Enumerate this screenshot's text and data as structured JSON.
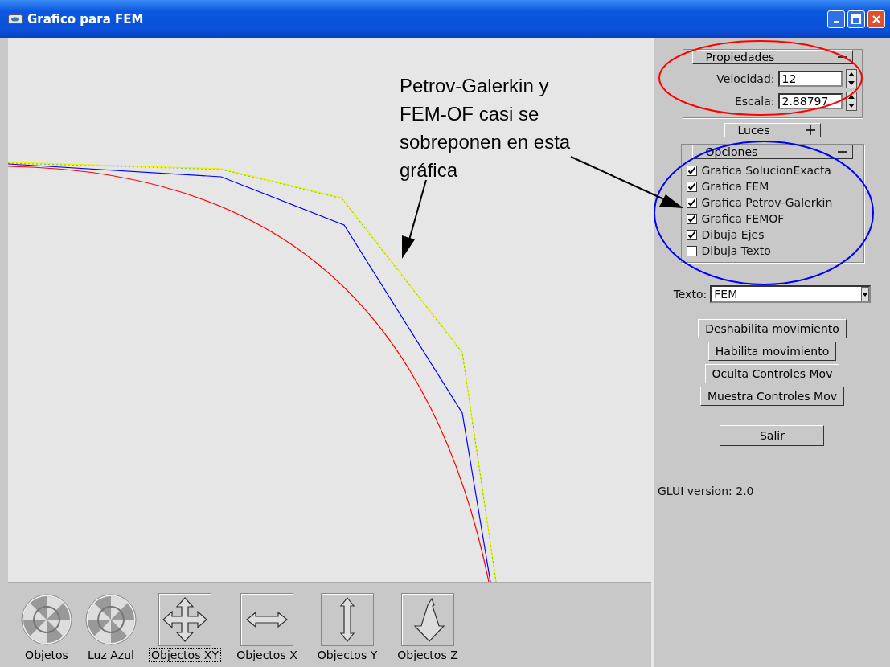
{
  "window": {
    "title": "Grafico para FEM"
  },
  "canvas": {
    "annotation": [
      "Petrov-Galerkin y",
      "FEM-OF casi se",
      "sobreponen en esta",
      "gráfica"
    ]
  },
  "panel": {
    "propiedades": {
      "title": "Propiedades",
      "expanded": true,
      "fields": [
        {
          "label": "Velocidad:",
          "value": "12"
        },
        {
          "label": "Escala:",
          "value": "2.88797"
        }
      ]
    },
    "luces": {
      "title": "Luces",
      "expanded": false
    },
    "opciones": {
      "title": "Opciones",
      "expanded": true,
      "checkboxes": [
        {
          "label": "Grafica SolucionExacta",
          "checked": true
        },
        {
          "label": "Grafica FEM",
          "checked": true
        },
        {
          "label": "Grafica Petrov-Galerkin",
          "checked": true
        },
        {
          "label": "Grafica FEMOF",
          "checked": true
        },
        {
          "label": "Dibuja Ejes",
          "checked": true
        },
        {
          "label": "Dibuja Texto",
          "checked": false
        }
      ]
    },
    "texto": {
      "label": "Texto:",
      "value": "FEM"
    },
    "buttons": [
      "Deshabilita movimiento",
      "Habilita movimiento",
      "Oculta Controles Mov",
      "Muestra Controles Mov"
    ],
    "exit_button": "Salir",
    "version": "GLUI version: 2.0"
  },
  "toolbar": [
    {
      "kind": "sphere",
      "label": "Objetos",
      "selected": false
    },
    {
      "kind": "sphere",
      "label": "Luz Azul",
      "selected": false
    },
    {
      "kind": "xy",
      "label": "Objectos XY",
      "selected": true
    },
    {
      "kind": "x",
      "label": "Objectos X",
      "selected": false
    },
    {
      "kind": "y",
      "label": "Objectos Y",
      "selected": false
    },
    {
      "kind": "z",
      "label": "Objectos Z",
      "selected": false
    }
  ]
}
